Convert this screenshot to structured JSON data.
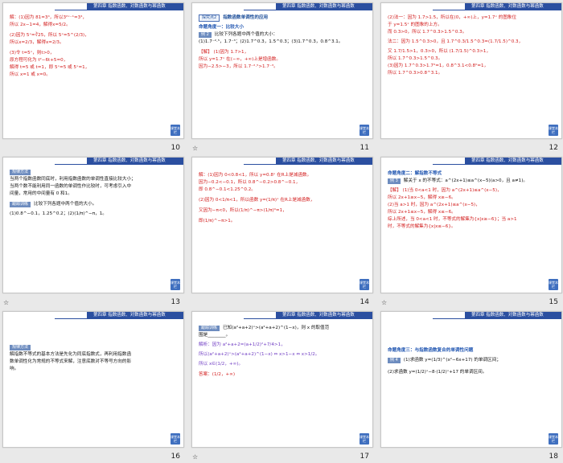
{
  "header": {
    "chapter_text": "第四章 指数函数、对数函数与幂函数",
    "corner_text": "课堂本栏"
  },
  "slides": [
    {
      "number": "10",
      "lines": [
        "解：(1)因为 81=3⁴，所以3²ˣ⁻¹=3⁴，",
        "所以 2x−1=4，解得x=5/2。",
        "(2)因为 5ˣ=∛25，所以 5ˣ=5^(2/3)，",
        "所以x=2/3，解得x=2/3。",
        "(3)令 t=5ˣ，则t>0，",
        "原方程可化为 t²−6t+5=0，",
        "解得 t=5 或 t=1，即 5ˣ=5 或 5ˣ=1，",
        "所以 x=1 或 x=0。"
      ]
    },
    {
      "number": "11",
      "section_tag": "探究点2",
      "section_title": "指数函数单调性的应用",
      "subheading": "命题角度一：比较大小",
      "example_label": "例 2",
      "question": "比较下列各题中两个值的大小：",
      "items": "(1)1.7⁻²·⁵，1.7⁻³；(2)1.7^0.3，1.5^0.3；(3)1.7^0.3，0.8^3.1。",
      "answer_lines": [
        "【解】 (1)因为 1.7>1，",
        "所以 y=1.7ˣ 在(−∞，+∞)上是增函数。",
        "因为−2.5>−3，所以 1.7⁻²·⁵>1.7⁻³。"
      ]
    },
    {
      "number": "12",
      "lines": [
        "(2)法一：因为 1.7>1.5，所以在(0，+∞)上，y=1.7ˣ 的图象位",
        "于 y=1.5ˣ 的图象的上方。",
        "而 0.3>0，所以 1.7^0.3>1.5^0.3。",
        "法二：因为 1.5^0.3>0，且 1.7^0.3/1.5^0.3=(1.7/1.5)^0.3，",
        "又 1.7/1.5>1，0.3>0，所以 (1.7/1.5)^0.3>1，",
        "所以 1.7^0.3>1.5^0.3。",
        "(3)因为 1.7^0.3>1.7⁰=1，0.8^3.1<0.8⁰=1，",
        "所以 1.7^0.3>0.8^3.1。"
      ]
    },
    {
      "number": "13",
      "tag": "规律方法",
      "lines": [
        "当两个指数函数同底时，利用指数函数的单调性直接比较大小；",
        "当两个数不能利用同一函数的单调性作比较时，可考虑引入中",
        "间量，常用的中间量有 0 和1。"
      ],
      "practice_tag": "跟踪训练",
      "practice_q": "比较下列各题中两个值的大小。",
      "practice_items": "(1)0.8^−0.1，1.25^0.2；(2)(1/π)^−π，1。"
    },
    {
      "number": "14",
      "lines": [
        "解：(1)因为 0<0.8<1，所以 y=0.8ˣ 在R上是减函数。",
        "因为−0.2<−0.1，所以 0.8^−0.2>0.8^−0.1，",
        "即 0.8^−0.1<1.25^0.2。",
        "(2)因为 0<1/π<1，所以函数 y=(1/π)ˣ 在R上是减函数，",
        "又因为−π<0，所以(1/π)^−π>(1/π)⁰=1，",
        "即(1/π)^−π>1。"
      ]
    },
    {
      "number": "15",
      "subheading": "命题角度二：解指数不等式",
      "example_label": "例 3",
      "question": "解关于 x 的不等式：a^(2x+1)≤a^(x−5)(a>0，且 a≠1)。",
      "answer_lines": [
        "【解】 (1)当 0<a<1 时，因为 a^(2x+1)≤a^(x−5)，",
        "所以 2x+1≥x−5，解得 x≥−6。",
        "(2)当 a>1 时，因为 a^(2x+1)≤a^(x−5)，",
        "所以 2x+1≤x−5，解得 x≤−6。",
        "综上所述，当 0<a<1 时，不等式的解集为{x|x≥−6}；当 a>1",
        "时，不等式的解集为{x|x≤−6}。"
      ]
    },
    {
      "number": "16",
      "tag": "规律方法",
      "lines": [
        "解指数不等式的基本方法是先化为同底指数式，再利用指数函",
        "数单调性化为常规的不等式来解，注意底数对不等号方向的影",
        "响。"
      ]
    },
    {
      "number": "17",
      "practice_tag": "跟踪训练",
      "question": "已知(a²+a+2)ˣ>(a²+a+2)^(1−x)，则 x 的取值范",
      "question_cont": "围是________。",
      "lines": [
        "解析：因为 a²+a+2=(a+1/2)²+7/4>1，",
        "所以(a²+a+2)ˣ>(a²+a+2)^(1−x) ⇔ x>1−x ⇔ x>1/2。",
        "所以 x∈(1/2，+∞)。"
      ],
      "answer": "答案：(1/2，+∞)"
    },
    {
      "number": "18",
      "subheading": "命题角度三：与指数函数复合的单调性问题",
      "example_label": "例 4",
      "item1": "(1)求函数 y=(1/3)^(x²−6x+17) 的单调区间；",
      "item2": "(2)求函数 y=(1/2)ˣ−8·(1/2)ˣ+17 的单调区间。"
    }
  ],
  "footer_icon": "star-icon"
}
